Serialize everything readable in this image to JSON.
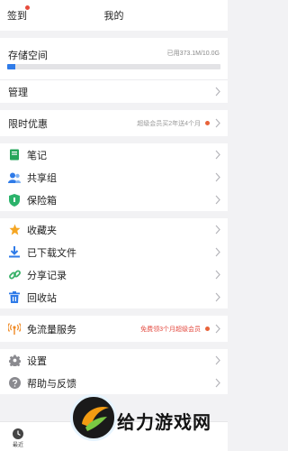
{
  "header": {
    "checkin_label": "签到",
    "title": "我的"
  },
  "storage": {
    "label": "存储空间",
    "used_text": "已用373.1M/10.0G",
    "used_fraction": 0.036
  },
  "manage": {
    "label": "管理"
  },
  "promo": {
    "label": "限时优惠",
    "note": "超级会员买2年送4个月"
  },
  "group1": [
    {
      "label": "笔记",
      "icon": "notebook-icon",
      "color": "#26a65b"
    },
    {
      "label": "共享组",
      "icon": "people-icon",
      "color": "#2f7be8"
    },
    {
      "label": "保险箱",
      "icon": "shield-icon",
      "color": "#2bb36b"
    }
  ],
  "group2": [
    {
      "label": "收藏夹",
      "icon": "star-icon",
      "color": "#f5a623"
    },
    {
      "label": "已下载文件",
      "icon": "download-icon",
      "color": "#2f7be8"
    },
    {
      "label": "分享记录",
      "icon": "link-icon",
      "color": "#3bb26a"
    },
    {
      "label": "回收站",
      "icon": "trash-icon",
      "color": "#2f7be8"
    }
  ],
  "data_service": {
    "label": "免流量服务",
    "note": "免费领3个月超级会员",
    "icon": "signal-icon",
    "color": "#f08a24"
  },
  "group3": [
    {
      "label": "设置",
      "icon": "gear-icon",
      "color": "#8a8a8f"
    },
    {
      "label": "帮助与反馈",
      "icon": "help-icon",
      "color": "#8a8a8f"
    }
  ],
  "tabbar": {
    "recent_label": "最近"
  },
  "watermark": {
    "text": "给力游戏网"
  }
}
